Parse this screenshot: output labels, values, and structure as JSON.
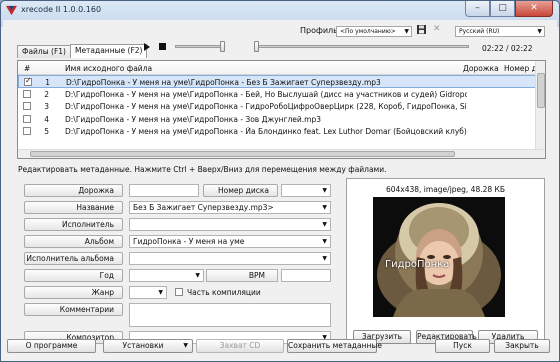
{
  "window": {
    "title": "xrecode II 1.0.0.160",
    "minimize_glyph": "–",
    "maximize_glyph": "□",
    "close_glyph": "✕"
  },
  "toolbar": {
    "profile_label": "Профиль",
    "profile_value": "<По умолчанию>",
    "language_value": "Русский (RU)",
    "time": "02:22 / 02:22"
  },
  "tabs": [
    {
      "label": "Файлы (F1)"
    },
    {
      "label": "Метаданные (F2)"
    }
  ],
  "list": {
    "headers": {
      "hash": "#",
      "file": "Имя исходного файла",
      "track": "Дорожка",
      "disc": "Номер д"
    },
    "rows": [
      {
        "num": "1",
        "file": "D:\\ГидроПонка - У меня на уме\\ГидроПонка - Без Б Зажигает Суперзвезду.mp3",
        "checked": true,
        "selected": true
      },
      {
        "num": "2",
        "file": "D:\\ГидроПонка - У меня на уме\\ГидроПонка - Бей, Но Выслушай (дисс на участников и судей) Gidroponka...",
        "checked": false,
        "selected": false
      },
      {
        "num": "3",
        "file": "D:\\ГидроПонка - У меня на уме\\ГидроПонка - ГидроРобоЦифроОверЦирк (228, Короб, ГидроПонка, Sight...",
        "checked": false,
        "selected": false
      },
      {
        "num": "4",
        "file": "D:\\ГидроПонка - У меня на уме\\ГидроПонка - Зов Джунглей.mp3",
        "checked": false,
        "selected": false
      },
      {
        "num": "5",
        "file": "D:\\ГидроПонка - У меня на уме\\ГидроПонка - Йа Блондинко feat. Lex Luthor  Domar (Бойцовский клуб).mp3",
        "checked": false,
        "selected": false
      }
    ]
  },
  "hint": "Редактировать метаданные. Нажмите Ctrl + Вверх/Вниз для перемещения между файлами.",
  "meta": {
    "track_label": "Дорожка",
    "disc_label": "Номер диска",
    "title_label": "Название",
    "title_value": "Без Б Зажигает Суперзвезду.mp3>",
    "artist_label": "Исполнитель",
    "album_label": "Альбом",
    "album_value": "ГидроПонка - У меня на уме",
    "album_artist_label": "Исполнитель альбома",
    "year_label": "Год",
    "bpm_label": "BPM",
    "genre_label": "Жанр",
    "compilation_label": "Часть компиляции",
    "comments_label": "Комментарии",
    "composer_label": "Композитор"
  },
  "image": {
    "info": "604x438, image/jpeg, 48.28 КБ",
    "watermark": "ГидроПонка",
    "load_label": "Загрузить",
    "edit_label": "Редактировать",
    "delete_label": "Удалить"
  },
  "footer": {
    "about_label": "О программе",
    "settings_label": "Установки",
    "grab_cd_label": "Захват CD",
    "save_meta_label": "Сохранить метаданные",
    "start_label": "Пуск",
    "close_label": "Закрыть"
  }
}
